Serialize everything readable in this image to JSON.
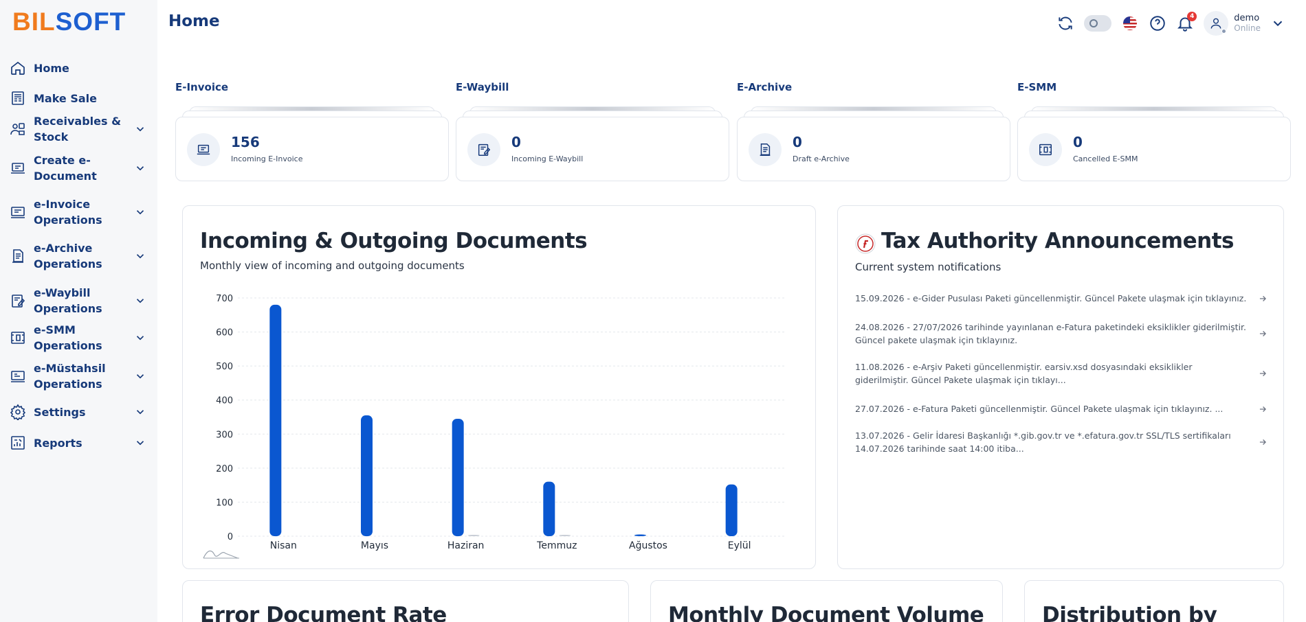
{
  "brand": {
    "logo_part1": "BIL",
    "logo_part2": "SOFT",
    "accent": "#f07b1e",
    "primary": "#1d5fd0"
  },
  "header": {
    "title": "Home",
    "notification_count": "4",
    "user_name": "demo",
    "user_status": "Online"
  },
  "sidebar": {
    "items": [
      {
        "label": "Home",
        "icon": "home-icon",
        "has_children": false
      },
      {
        "label": "Make Sale",
        "icon": "receipt-icon",
        "has_children": false
      },
      {
        "label": "Receivables & Stock",
        "icon": "people-box-icon",
        "has_children": true
      },
      {
        "label": "Create e-Document",
        "icon": "laptop-icon",
        "has_children": true
      },
      {
        "label": "e-Invoice Operations",
        "icon": "invoice-icon",
        "has_children": true
      },
      {
        "label": "e-Archive Operations",
        "icon": "archive-icon",
        "has_children": true
      },
      {
        "label": "e-Waybill Operations",
        "icon": "waybill-icon",
        "has_children": true
      },
      {
        "label": "e-SMM Operations",
        "icon": "smm-icon",
        "has_children": true
      },
      {
        "label": "e-Müstahsil Operations",
        "icon": "mustahsil-icon",
        "has_children": true
      },
      {
        "label": "Settings",
        "icon": "gear-icon",
        "has_children": true
      },
      {
        "label": "Reports",
        "icon": "report-icon",
        "has_children": true
      }
    ]
  },
  "summary": [
    {
      "title": "E-Invoice",
      "value": "156",
      "label": "Incoming E-Invoice"
    },
    {
      "title": "E-Waybill",
      "value": "0",
      "label": "Incoming E-Waybill"
    },
    {
      "title": "E-Archive",
      "value": "0",
      "label": "Draft e-Archive"
    },
    {
      "title": "E-SMM",
      "value": "0",
      "label": "Cancelled E-SMM"
    }
  ],
  "documents_panel": {
    "title": "Incoming & Outgoing Documents",
    "subtitle": "Monthly view of incoming and outgoing documents"
  },
  "chart_data": {
    "type": "bar",
    "categories": [
      "Nisan",
      "Mayıs",
      "Haziran",
      "Temmuz",
      "Ağustos",
      "Eylül"
    ],
    "series": [
      {
        "values": [
          680,
          355,
          345,
          160,
          5,
          152
        ],
        "color": "#0a57d0"
      },
      {
        "values": [
          0,
          0,
          2,
          2,
          0,
          0
        ],
        "color": "#c9ced6"
      }
    ],
    "yticks": [
      0,
      100,
      200,
      300,
      400,
      500,
      600,
      700
    ],
    "ylim": [
      0,
      700
    ],
    "grid": true
  },
  "announcements_panel": {
    "title": "Tax Authority Announcements",
    "subtitle": "Current system notifications",
    "items": [
      "15.09.2026 - e-Gider Pusulası Paketi güncellenmiştir. Güncel Pakete ulaşmak için tıklayınız.",
      "24.08.2026 - 27/07/2026 tarihinde yayınlanan e-Fatura paketindeki eksiklikler giderilmiştir. Güncel pakete ulaşmak için tıklayınız.",
      "11.08.2026 - e-Arşiv Paketi güncellenmiştir. earsiv.xsd dosyasındaki eksiklikler giderilmiştir. Güncel Pakete ulaşmak için tıklayı...",
      "27.07.2026 - e-Fatura Paketi güncellenmiştir. Güncel Pakete ulaşmak için tıklayınız. ...",
      "13.07.2026 - Gelir İdaresi Başkanlığı *.gib.gov.tr ve *.efatura.gov.tr SSL/TLS sertifikaları 14.07.2026 tarihinde saat 14:00 itiba..."
    ]
  },
  "bottom_panels": [
    {
      "title": "Error Document Rate"
    },
    {
      "title": "Monthly Document Volume"
    },
    {
      "title": "Distribution by"
    }
  ]
}
